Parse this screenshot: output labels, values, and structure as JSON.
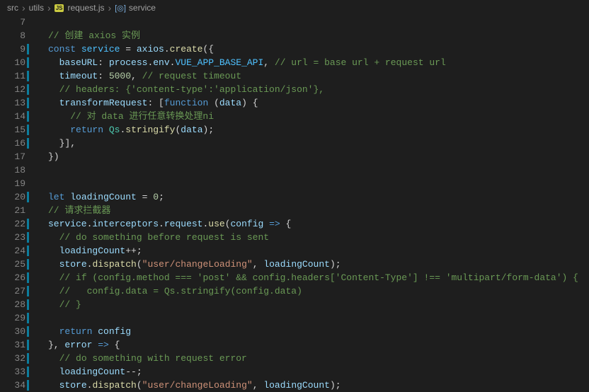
{
  "breadcrumb": {
    "src": "src",
    "utils": "utils",
    "file": "request.js",
    "symbol": "service"
  },
  "lines": {
    "start": 7,
    "modified": [
      9,
      10,
      11,
      12,
      13,
      14,
      15,
      16,
      20,
      22,
      23,
      24,
      25,
      26,
      27,
      28,
      29,
      30,
      31,
      32,
      33,
      34
    ]
  },
  "code": {
    "l8_comment": "// 创建 axios 实例",
    "l9_const": "const",
    "l9_service": "service",
    "l9_eq": " = ",
    "l9_axios": "axios",
    "l9_create": "create",
    "l10_baseURL": "baseURL",
    "l10_process": "process",
    "l10_env": "env",
    "l10_APIVAR": "VUE_APP_BASE_API",
    "l10_comment": "// url = base url + request url",
    "l11_timeout": "timeout",
    "l11_val": "5000",
    "l11_comment": "// request timeout",
    "l12_comment": "// headers: {'content-type':'application/json'},",
    "l13_transform": "transformRequest",
    "l13_function": "function",
    "l13_data": "data",
    "l14_comment": "// 对 data 进行任意转换处理ni",
    "l15_return": "return",
    "l15_Qs": "Qs",
    "l15_stringify": "stringify",
    "l15_data": "data",
    "l20_let": "let",
    "l20_loadingCount": "loadingCount",
    "l20_val": "0",
    "l21_comment": "// 请求拦截器",
    "l22_service": "service",
    "l22_interceptors": "interceptors",
    "l22_request": "request",
    "l22_use": "use",
    "l22_config": "config",
    "l23_comment": "// do something before request is sent",
    "l24_loadingCount": "loadingCount",
    "l25_store": "store",
    "l25_dispatch": "dispatch",
    "l25_path": "\"user/changeLoading\"",
    "l25_loadingCount": "loadingCount",
    "l26_comment": "// if (config.method === 'post' && config.headers['Content-Type'] !== 'multipart/form-data') {",
    "l27_comment": "//   config.data = Qs.stringify(config.data)",
    "l28_comment": "// }",
    "l30_return": "return",
    "l30_config": "config",
    "l31_error": "error",
    "l32_comment": "// do something with request error",
    "l33_loadingCount": "loadingCount",
    "l34_store": "store",
    "l34_dispatch": "dispatch",
    "l34_path": "\"user/changeLoading\"",
    "l34_loadingCount": "loadingCount"
  }
}
